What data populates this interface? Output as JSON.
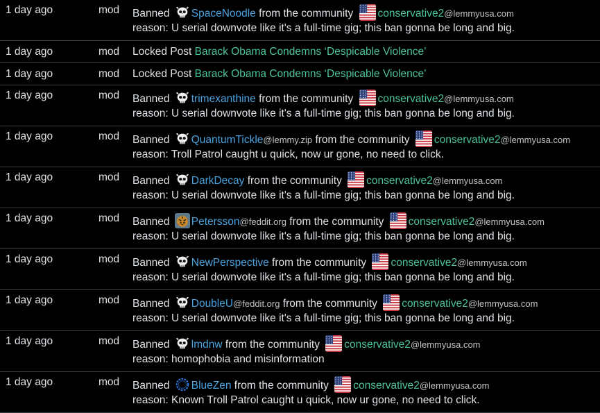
{
  "log": {
    "rows": [
      {
        "time": "1 day ago",
        "actor": "mod",
        "verb": "Banned ",
        "avatar": "skull-icon",
        "user": "SpaceNoodle",
        "user_instance": "",
        "mid": " from the community ",
        "community": "conservative2",
        "community_instance": "@lemmyusa.com",
        "reason": "reason: U serial downvote like it's a full-time gig; this ban gonna be long and big."
      },
      {
        "time": "1 day ago",
        "actor": "mod",
        "verb": "Locked Post ",
        "post": "Barack Obama Condemns ‘Despicable Violence’"
      },
      {
        "time": "1 day ago",
        "actor": "mod",
        "verb": "Locked Post ",
        "post": "Barack Obama Condemns ‘Despicable Violence’"
      },
      {
        "time": "1 day ago",
        "actor": "mod",
        "verb": "Banned ",
        "avatar": "skull-icon",
        "user": "trimexanthine",
        "user_instance": "",
        "mid": " from the community ",
        "community": "conservative2",
        "community_instance": "@lemmyusa.com",
        "reason": "reason: U serial downvote like it's a full-time gig; this ban gonna be long and big."
      },
      {
        "time": "1 day ago",
        "actor": "mod",
        "verb": "Banned ",
        "avatar": "skull-icon",
        "user": "QuantumTickle",
        "user_instance": "@lemmy.zip",
        "mid": " from the community ",
        "community": "conservative2",
        "community_instance": "@lemmyusa.com",
        "reason": "reason: Troll Patrol caught u quick, now ur gone, no need to click."
      },
      {
        "time": "1 day ago",
        "actor": "mod",
        "verb": "Banned ",
        "avatar": "skull-icon",
        "user": "DarkDecay",
        "user_instance": "",
        "mid": " from the community ",
        "community": "conservative2",
        "community_instance": "@lemmyusa.com",
        "reason": "reason: U serial downvote like it's a full-time gig; this ban gonna be long and big."
      },
      {
        "time": "1 day ago",
        "actor": "mod",
        "verb": "Banned ",
        "avatar": "tiger-avatar-icon",
        "user": "Petersson",
        "user_instance": "@feddit.org",
        "mid": " from the community ",
        "community": "conservative2",
        "community_instance": "@lemmyusa.com",
        "reason": "reason: U serial downvote like it's a full-time gig; this ban gonna be long and big."
      },
      {
        "time": "1 day ago",
        "actor": "mod",
        "verb": "Banned ",
        "avatar": "skull-icon",
        "user": "NewPerspective",
        "user_instance": "",
        "mid": " from the community ",
        "community": "conservative2",
        "community_instance": "@lemmyusa.com",
        "reason": "reason: U serial downvote like it's a full-time gig; this ban gonna be long and big."
      },
      {
        "time": "1 day ago",
        "actor": "mod",
        "verb": "Banned ",
        "avatar": "skull-icon",
        "user": "DoubleU",
        "user_instance": "@feddit.org",
        "mid": " from the community ",
        "community": "conservative2",
        "community_instance": "@lemmyusa.com",
        "reason": "reason: U serial downvote like it's a full-time gig; this ban gonna be long and big."
      },
      {
        "time": "1 day ago",
        "actor": "mod",
        "verb": "Banned ",
        "avatar": "skull-icon",
        "user": "lmdnw",
        "user_instance": "",
        "mid": " from the community ",
        "community": "conservative2",
        "community_instance": "@lemmyusa.com",
        "reason": "reason: homophobia and misinformation"
      },
      {
        "time": "1 day ago",
        "actor": "mod",
        "verb": "Banned ",
        "avatar": "blue-ring-avatar-icon",
        "user": "BlueZen",
        "user_instance": "",
        "mid": " from the community ",
        "community": "conservative2",
        "community_instance": "@lemmyusa.com",
        "reason": "reason: Known Troll Patrol caught u quick, now ur gone, no need to click."
      }
    ]
  },
  "colors": {
    "background": "#000000",
    "text": "#dee2e6",
    "user_link": "#4aa3df",
    "community_link": "#4cc49a",
    "divider": "#3a3f44"
  },
  "community_icon": "us-flag-icon"
}
